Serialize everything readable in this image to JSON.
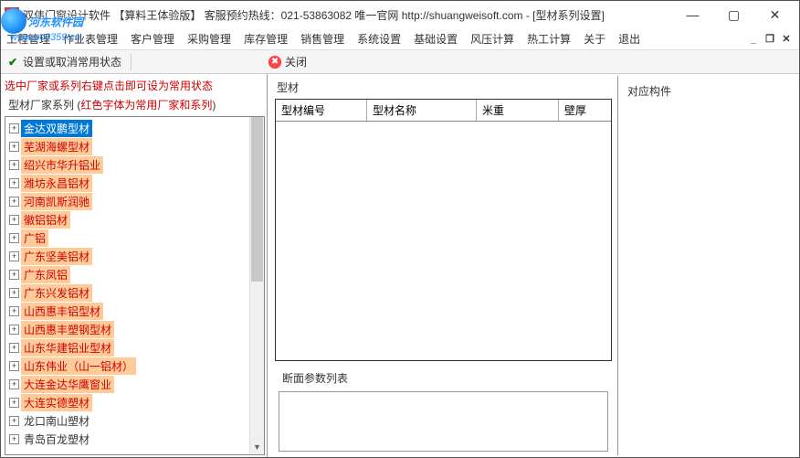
{
  "window": {
    "title": "双伟门窗设计软件     【算料王体验版】     客服预约热线：021-53863082    唯一官网 http://shuangweisoft.com  - [型材系列设置]",
    "min": "—",
    "max": "▢",
    "close": "✕"
  },
  "watermark": {
    "top": "河东软件园",
    "bottom": "www.pc0359.cn"
  },
  "menu": [
    "工程管理",
    "作业表管理",
    "客户管理",
    "采购管理",
    "库存管理",
    "销售管理",
    "系统设置",
    "基础设置",
    "风压计算",
    "热工计算",
    "关于",
    "退出"
  ],
  "mdi": {
    "min": "_",
    "restore": "❐",
    "close": "✕"
  },
  "toolbar": {
    "toggle_status": "设置或取消常用状态",
    "close": "关闭"
  },
  "left": {
    "hint": "选中厂家或系列右键点击即可设为常用状态",
    "subhint_prefix": "型材厂家系列 (",
    "subhint_red": "红色字体为常用厂家和系列",
    "subhint_suffix": ")"
  },
  "tree": [
    {
      "label": "金达双鹏型材",
      "style": "selected",
      "expand": "+"
    },
    {
      "label": "芜湖海螺型材",
      "style": "highlighted",
      "expand": "+"
    },
    {
      "label": "绍兴市华升铝业",
      "style": "highlighted",
      "expand": "+"
    },
    {
      "label": "潍坊永昌铝材",
      "style": "highlighted",
      "expand": "+"
    },
    {
      "label": "河南凯斯润驰",
      "style": "highlighted",
      "expand": "+"
    },
    {
      "label": "徽铝铝材",
      "style": "highlighted",
      "expand": "+"
    },
    {
      "label": "广铝",
      "style": "highlighted",
      "expand": "+"
    },
    {
      "label": "广东坚美铝材",
      "style": "highlighted",
      "expand": "+"
    },
    {
      "label": "广东凤铝",
      "style": "highlighted",
      "expand": "+"
    },
    {
      "label": "广东兴发铝材",
      "style": "highlighted",
      "expand": "+"
    },
    {
      "label": "山西惠丰铝型材",
      "style": "highlighted",
      "expand": "+"
    },
    {
      "label": "山西惠丰塑钢型材",
      "style": "highlighted",
      "expand": "+"
    },
    {
      "label": "山东华建铝业型材",
      "style": "highlighted",
      "expand": "+"
    },
    {
      "label": "山东伟业（山一铝材）",
      "style": "highlighted",
      "expand": "+"
    },
    {
      "label": "大连金达华鹰窗业",
      "style": "highlighted",
      "expand": "+"
    },
    {
      "label": "大连实德塑材",
      "style": "highlighted",
      "expand": "+"
    },
    {
      "label": "龙口南山塑材",
      "style": "normal",
      "expand": "+"
    },
    {
      "label": "青岛百龙塑材",
      "style": "normal",
      "expand": "+"
    }
  ],
  "center": {
    "group_label": "型材",
    "columns": [
      "型材编号",
      "型材名称",
      "米重",
      "壁厚"
    ]
  },
  "side": {
    "group_label": "对应构件"
  },
  "bottom": {
    "group_label": "断面参数列表"
  }
}
